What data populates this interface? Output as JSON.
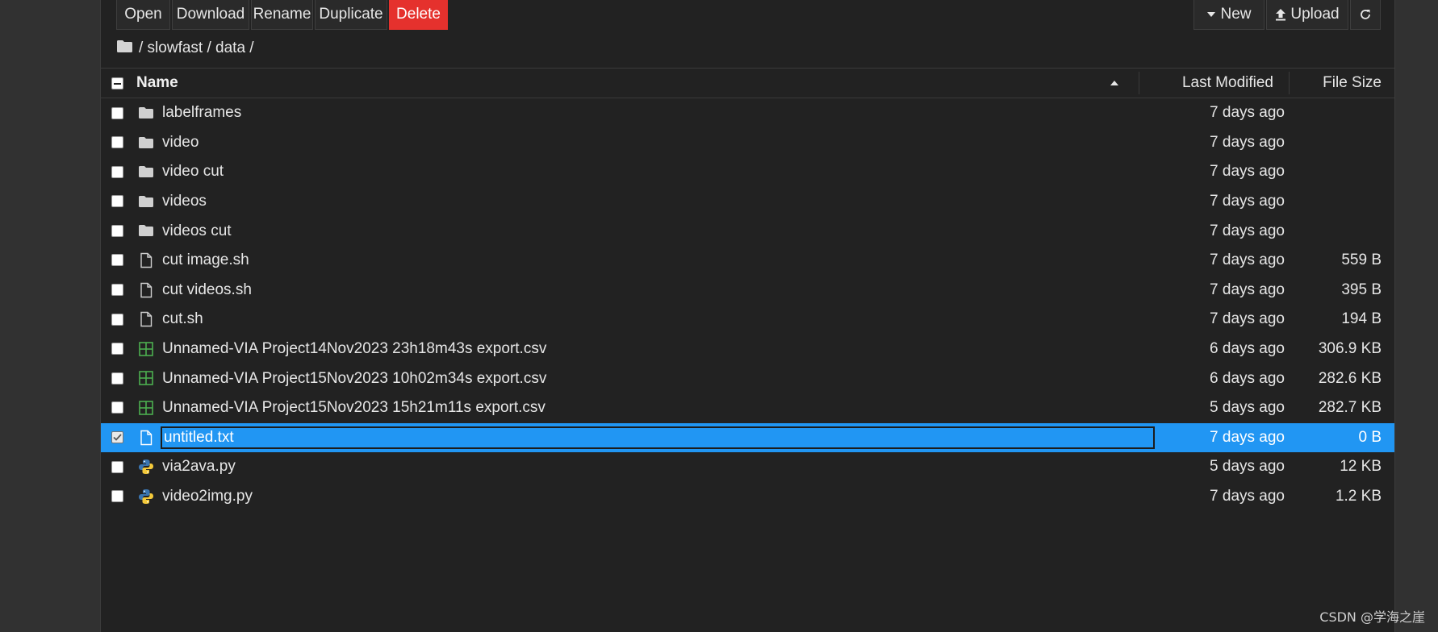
{
  "toolbar": {
    "open": "Open",
    "download": "Download",
    "rename": "Rename",
    "duplicate": "Duplicate",
    "delete": "Delete",
    "new": "New",
    "upload": "Upload",
    "refresh_icon": "refresh-icon",
    "delete_color": "#e5312d"
  },
  "breadcrumb": {
    "path": "/ slowfast / data /",
    "icon": "folder-icon"
  },
  "header": {
    "name": "Name",
    "last_modified": "Last Modified",
    "file_size": "File Size",
    "sort_icon": "sort-ascending-icon"
  },
  "files": [
    {
      "name": "labelframes",
      "type": "folder",
      "modified": "7 days ago",
      "size": ""
    },
    {
      "name": "video",
      "type": "folder",
      "modified": "7 days ago",
      "size": ""
    },
    {
      "name": "video cut",
      "type": "folder",
      "modified": "7 days ago",
      "size": ""
    },
    {
      "name": "videos",
      "type": "folder",
      "modified": "7 days ago",
      "size": ""
    },
    {
      "name": "videos cut",
      "type": "folder",
      "modified": "7 days ago",
      "size": ""
    },
    {
      "name": "cut image.sh",
      "type": "file",
      "modified": "7 days ago",
      "size": "559 B"
    },
    {
      "name": "cut videos.sh",
      "type": "file",
      "modified": "7 days ago",
      "size": "395 B"
    },
    {
      "name": "cut.sh",
      "type": "file",
      "modified": "7 days ago",
      "size": "194 B"
    },
    {
      "name": "Unnamed-VIA Project14Nov2023 23h18m43s export.csv",
      "type": "csv",
      "modified": "6 days ago",
      "size": "306.9 KB"
    },
    {
      "name": "Unnamed-VIA Project15Nov2023 10h02m34s export.csv",
      "type": "csv",
      "modified": "6 days ago",
      "size": "282.6 KB"
    },
    {
      "name": "Unnamed-VIA Project15Nov2023 15h21m11s export.csv",
      "type": "csv",
      "modified": "5 days ago",
      "size": "282.7 KB"
    },
    {
      "name": "untitled.txt",
      "type": "file",
      "modified": "7 days ago",
      "size": "0 B",
      "selected": true,
      "editing": true
    },
    {
      "name": "via2ava.py",
      "type": "python",
      "modified": "5 days ago",
      "size": "12 KB"
    },
    {
      "name": "video2img.py",
      "type": "python",
      "modified": "7 days ago",
      "size": "1.2 KB"
    }
  ],
  "colors": {
    "selected_row": "#2196f3",
    "csv_icon": "#4caf50",
    "python_blue": "#3a75b0",
    "python_yellow": "#f4c93a"
  },
  "watermark": "CSDN @学海之崖"
}
